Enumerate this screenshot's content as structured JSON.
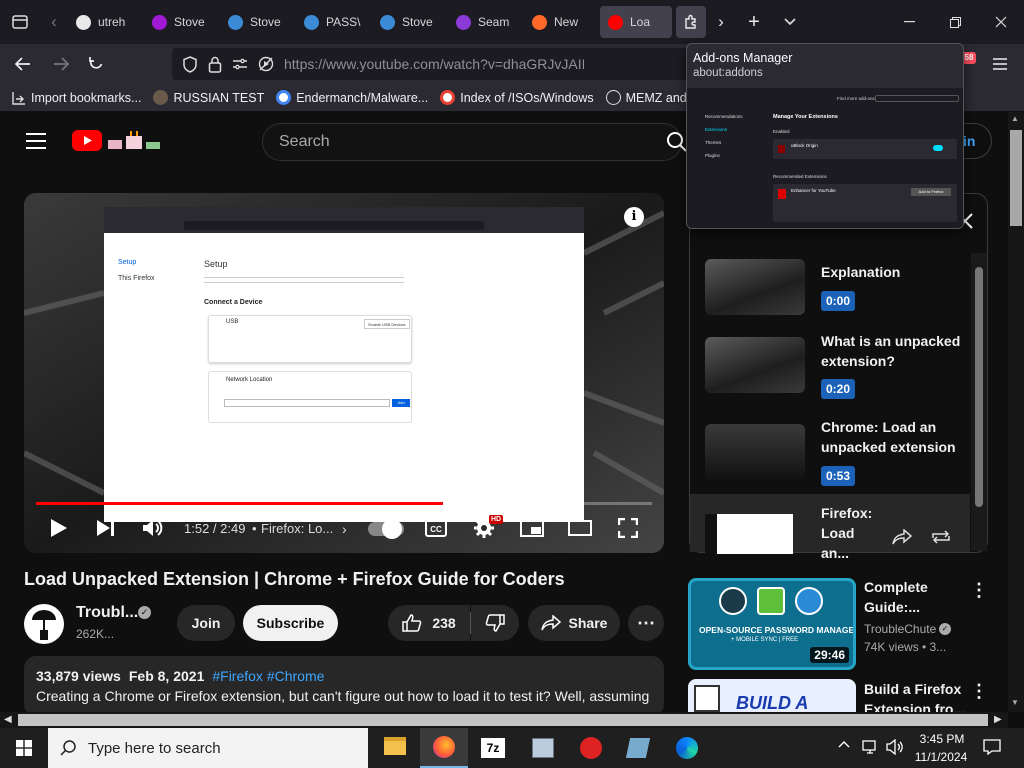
{
  "browser": {
    "tabs": [
      {
        "label": "utreh",
        "color": "#e8e8e8"
      },
      {
        "label": "Stove",
        "color": "#a01ad6"
      },
      {
        "label": "Stove",
        "color": "#3b8bd6"
      },
      {
        "label": "PASS\\",
        "color": "#3b8bd6"
      },
      {
        "label": "Stove",
        "color": "#3b8bd6"
      },
      {
        "label": "Seam",
        "color": "#8a3ad6"
      },
      {
        "label": "New",
        "color": "#ff6a2a"
      },
      {
        "label": "Loa",
        "color": "#ff0000"
      }
    ],
    "url": "https://www.youtube.com/watch?v=dhaGRJvJAII",
    "extension_badge": "58",
    "bookmarks": [
      {
        "label": "Import bookmarks..."
      },
      {
        "label": "RUSSIAN TEST"
      },
      {
        "label": "Endermanch/Malware..."
      },
      {
        "label": "Index of /ISOs/Windows"
      },
      {
        "label": "MEMZ and Noes"
      }
    ]
  },
  "addons_popup": {
    "title": "Add-ons Manager",
    "subtitle": "about:addons",
    "find_label": "Find more add-ons",
    "nav": [
      "Recommendations",
      "Extensions",
      "Themes",
      "Plugins"
    ],
    "heading": "Manage Your Extensions",
    "enabled_label": "Enabled",
    "ext_name": "uBlock Origin",
    "recommended_label": "Recommended Extensions",
    "rec_name": "Enhancer for YouTube",
    "rec_button": "Add to Firefox"
  },
  "youtube": {
    "search_placeholder": "Search",
    "signin_label": "in",
    "player": {
      "time": "1:52 / 2:49",
      "chapter": "Firefox: Lo...",
      "hd_badge": "HD",
      "progress": 0.66,
      "screen": {
        "setup_label": "Setup",
        "sidebar_item": "This Firefox",
        "connect_heading": "Connect a Device",
        "usb_label": "USB",
        "usb_button": "Enable USB Devices",
        "network_heading": "Network Location",
        "network_button": "Add"
      }
    },
    "video_title": "Load Unpacked Extension | Chrome + Firefox Guide for Coders",
    "channel_name": "Troubl...",
    "subscribers": "262K...",
    "join_label": "Join",
    "subscribe_label": "Subscribe",
    "likes": "238",
    "share_label": "Share",
    "views": "33,879 views",
    "date": "Feb 8, 2021",
    "hashtags": "#Firefox #Chrome",
    "description": "Creating a Chrome or Firefox extension, but can't figure out how to load it to test it? Well, assuming",
    "playlist": [
      {
        "title": "Explanation",
        "time": "0:00"
      },
      {
        "title": "What is an unpacked extension?",
        "time": "0:20"
      },
      {
        "title": "Chrome: Load an unpacked extension",
        "time": "0:53"
      },
      {
        "title": "Firefox: Load an...",
        "time": ""
      }
    ],
    "recommended": [
      {
        "title": "Complete Guide:...",
        "channel": "TroubleChute",
        "meta": "74K views • 3...",
        "duration": "29:46",
        "thumb_text": "OPEN-SOURCE PASSWORD MANAGER",
        "thumb_sub": "+ MOBILE SYNC | FREE"
      },
      {
        "title": "Build a Firefox Extension fro...",
        "thumb_text": "BUILD A"
      }
    ]
  },
  "taskbar": {
    "search_placeholder": "Type here to search",
    "time": "3:45 PM",
    "date": "11/1/2024"
  }
}
